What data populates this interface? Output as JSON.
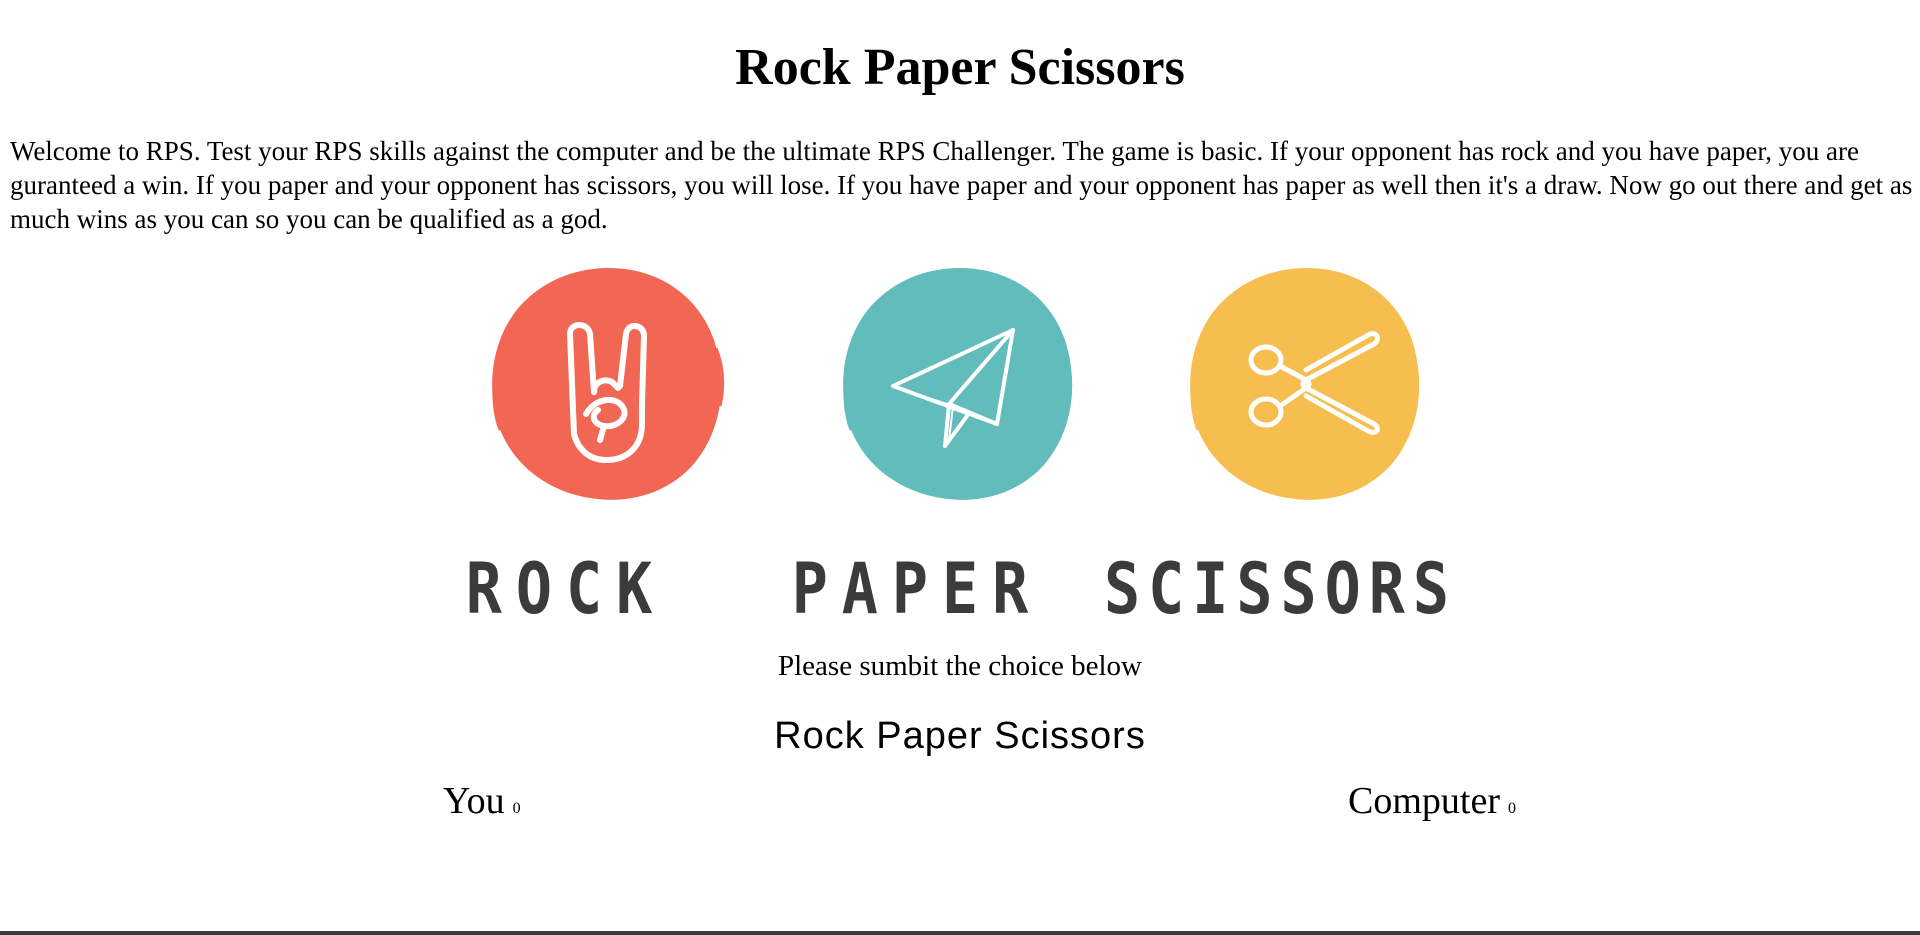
{
  "page": {
    "title": "Rock Paper Scissors",
    "intro": "Welcome to RPS. Test your RPS skills against the computer and be the ultimate RPS Challenger. The game is basic. If your opponent has rock and you have paper, you are guranteed a win. If you paper and your opponent has scissors, you will lose. If you have paper and your opponent has paper as well then it's a draw. Now go out there and get as much wins as you can so you can be qualified as a god."
  },
  "choices": [
    {
      "label": "ROCK",
      "icon": "rock-hand-icon",
      "color": "#F26654"
    },
    {
      "label": "PAPER",
      "icon": "paper-plane-icon",
      "color": "#62BCBB"
    },
    {
      "label": "SCISSORS",
      "icon": "scissors-icon",
      "color": "#F6BE4E"
    }
  ],
  "prompt": "Please sumbit the choice below",
  "game": {
    "heading": "Rock Paper Scissors",
    "user_label": "You",
    "user_score": "0",
    "computer_label": "Computer",
    "computer_score": "0"
  }
}
